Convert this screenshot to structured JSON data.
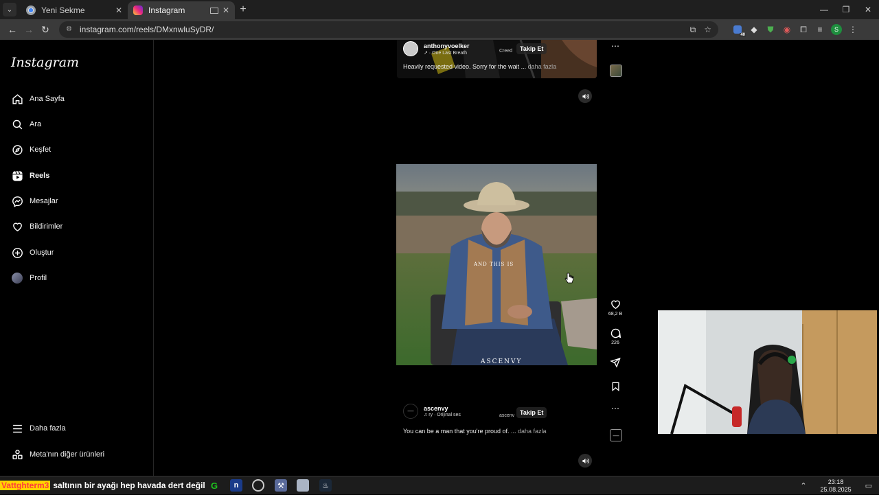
{
  "browser": {
    "tabs": [
      {
        "title": "Yeni Sekme",
        "active": false
      },
      {
        "title": "Instagram",
        "active": true
      }
    ],
    "url": "instagram.com/reels/DMxnwluSyDR/",
    "extension_badge": "40",
    "profile_letter": "S"
  },
  "sidebar": {
    "logo": "Instagram",
    "items": [
      {
        "label": "Ana Sayfa",
        "icon": "home-icon"
      },
      {
        "label": "Ara",
        "icon": "search-icon"
      },
      {
        "label": "Keşfet",
        "icon": "compass-icon"
      },
      {
        "label": "Reels",
        "icon": "reels-icon"
      },
      {
        "label": "Mesajlar",
        "icon": "messenger-icon"
      },
      {
        "label": "Bildirimler",
        "icon": "heart-icon"
      },
      {
        "label": "Oluştur",
        "icon": "plus-square-icon"
      },
      {
        "label": "Profil",
        "icon": "profile-avatar"
      }
    ],
    "bottom": [
      {
        "label": "Daha fazla",
        "icon": "menu-icon"
      },
      {
        "label": "Meta'nın diğer ürünleri",
        "icon": "meta-apps-icon"
      }
    ]
  },
  "reel_top": {
    "username": "anthonyvoelker",
    "audio": "One Last Breath",
    "credit": "Creed",
    "follow_label": "Takip Et",
    "caption": "Heavily requested video. Sorry for the wait ...",
    "more_label": "daha fazla"
  },
  "reel_main": {
    "overlay_text": "AND THIS IS",
    "watermark": "ASCENVY",
    "username": "ascenvy",
    "audio": "ry · Orijinal ses",
    "credit": "ascenv",
    "follow_label": "Takip Et",
    "caption": "You can be a man that you're proud of. ...",
    "more_label": "daha fazla",
    "likes": "68,2 B",
    "comments": "226"
  },
  "taskbar": {
    "ticker_name": "Vattghterm3",
    "ticker_message": "saltının bir ayağı hep havada dert değil",
    "time": "23:18",
    "date": "25.08.2025"
  }
}
